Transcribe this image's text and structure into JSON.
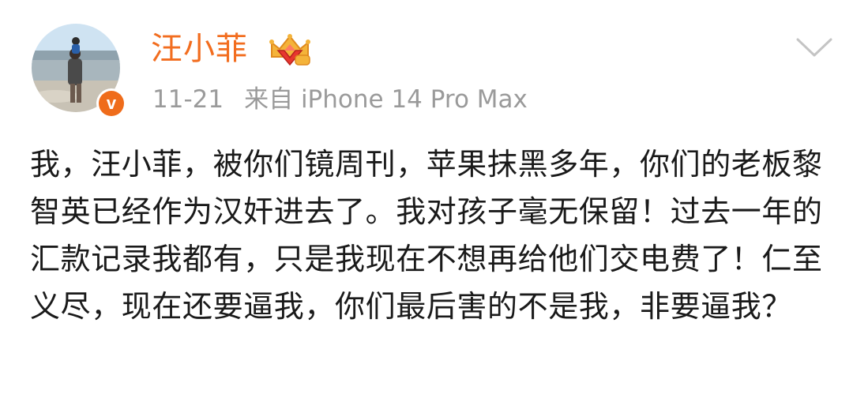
{
  "user": {
    "name": "汪小菲",
    "verified_symbol": "v",
    "avatar_icon": "avatar-beach-photo",
    "member_badge_icon": "crown-diamond-member-icon"
  },
  "post": {
    "date": "11-21",
    "source": "来自 iPhone 14 Pro Max",
    "text": "我，汪小菲，被你们镜周刊，苹果抹黑多年，你们的老板黎智英已经作为汉奸进去了。我对孩子毫无保留！过去一年的汇款记录我都有，只是我现在不想再给他们交电费了！仁至义尽，现在还要逼我，你们最后害的不是我，非要逼我？"
  },
  "colors": {
    "username": "#f26d1f",
    "meta": "#9a9a9a",
    "text": "#1a1a1a",
    "verified": "#ef6c1b"
  }
}
